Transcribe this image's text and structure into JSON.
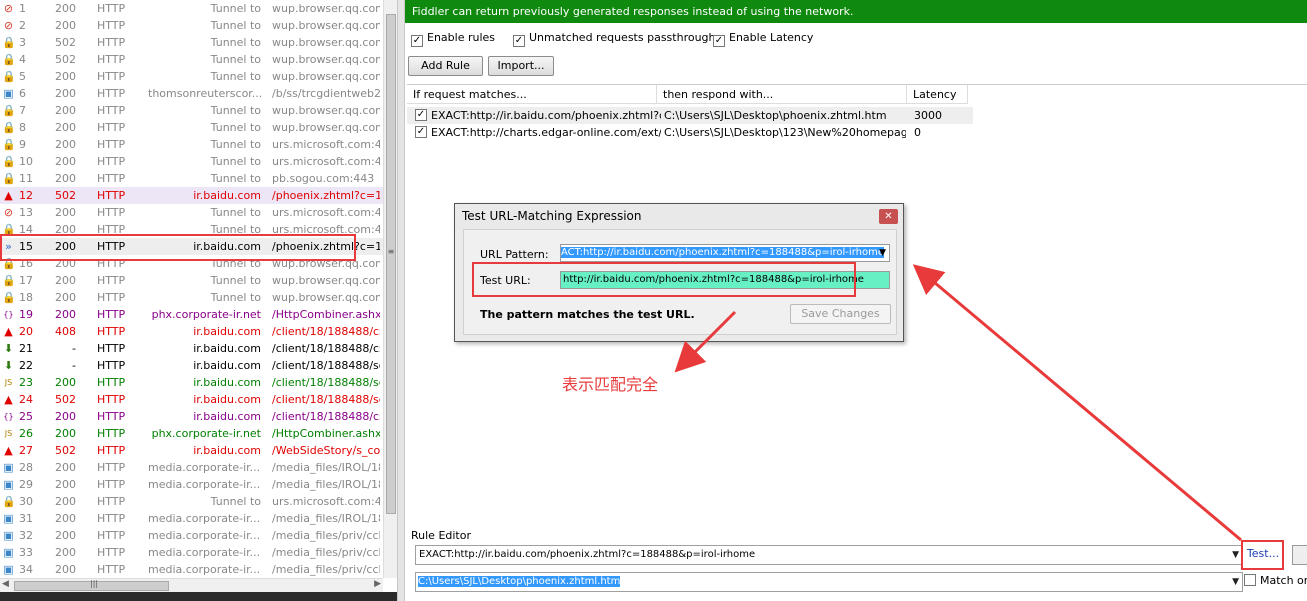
{
  "sessions": [
    {
      "num": "1",
      "result": "200",
      "proto": "HTTP",
      "host": "Tunnel to",
      "url": "wup.browser.qq.com:",
      "icon": "blocked-icon",
      "style": "gray"
    },
    {
      "num": "2",
      "result": "200",
      "proto": "HTTP",
      "host": "Tunnel to",
      "url": "wup.browser.qq.com:",
      "icon": "blocked-icon",
      "style": "gray"
    },
    {
      "num": "3",
      "result": "502",
      "proto": "HTTP",
      "host": "Tunnel to",
      "url": "wup.browser.qq.com:",
      "icon": "lock-icon",
      "style": "gray"
    },
    {
      "num": "4",
      "result": "502",
      "proto": "HTTP",
      "host": "Tunnel to",
      "url": "wup.browser.qq.com:",
      "icon": "lock-icon",
      "style": "gray"
    },
    {
      "num": "5",
      "result": "200",
      "proto": "HTTP",
      "host": "Tunnel to",
      "url": "wup.browser.qq.com:",
      "icon": "lock-icon",
      "style": "gray"
    },
    {
      "num": "6",
      "result": "200",
      "proto": "HTTP",
      "host": "thomsonreuterscor...",
      "url": "/b/ss/trcgdientweb20",
      "icon": "image-icon",
      "style": "gray"
    },
    {
      "num": "7",
      "result": "200",
      "proto": "HTTP",
      "host": "Tunnel to",
      "url": "wup.browser.qq.com:",
      "icon": "lock-icon",
      "style": "gray"
    },
    {
      "num": "8",
      "result": "200",
      "proto": "HTTP",
      "host": "Tunnel to",
      "url": "wup.browser.qq.com:",
      "icon": "lock-icon",
      "style": "gray"
    },
    {
      "num": "9",
      "result": "200",
      "proto": "HTTP",
      "host": "Tunnel to",
      "url": "urs.microsoft.com:443",
      "icon": "lock-icon",
      "style": "gray"
    },
    {
      "num": "10",
      "result": "200",
      "proto": "HTTP",
      "host": "Tunnel to",
      "url": "urs.microsoft.com:443",
      "icon": "lock-icon",
      "style": "gray"
    },
    {
      "num": "11",
      "result": "200",
      "proto": "HTTP",
      "host": "Tunnel to",
      "url": "pb.sogou.com:443",
      "icon": "lock-icon",
      "style": "gray"
    },
    {
      "num": "12",
      "result": "502",
      "proto": "HTTP",
      "host": "ir.baidu.com",
      "url": "/phoenix.zhtml?c=188",
      "icon": "warning-icon",
      "style": "red sel12"
    },
    {
      "num": "13",
      "result": "200",
      "proto": "HTTP",
      "host": "Tunnel to",
      "url": "urs.microsoft.com:443",
      "icon": "blocked-icon",
      "style": "gray"
    },
    {
      "num": "14",
      "result": "200",
      "proto": "HTTP",
      "host": "Tunnel to",
      "url": "urs.microsoft.com:443",
      "icon": "lock-icon",
      "style": "gray"
    },
    {
      "num": "15",
      "result": "200",
      "proto": "HTTP",
      "host": "ir.baidu.com",
      "url": "/phoenix.zhtml?c=188",
      "icon": "autoresponder-icon",
      "style": "black sel15"
    },
    {
      "num": "16",
      "result": "200",
      "proto": "HTTP",
      "host": "Tunnel to",
      "url": "wup.browser.qq.com:",
      "icon": "lock-icon",
      "style": "gray"
    },
    {
      "num": "17",
      "result": "200",
      "proto": "HTTP",
      "host": "Tunnel to",
      "url": "wup.browser.qq.com:",
      "icon": "lock-icon",
      "style": "gray"
    },
    {
      "num": "18",
      "result": "200",
      "proto": "HTTP",
      "host": "Tunnel to",
      "url": "wup.browser.qq.com:",
      "icon": "lock-icon",
      "style": "gray"
    },
    {
      "num": "19",
      "result": "200",
      "proto": "HTTP",
      "host": "phx.corporate-ir.net",
      "url": "/HttpCombiner.ashx?s",
      "icon": "css-icon",
      "style": "purple"
    },
    {
      "num": "20",
      "result": "408",
      "proto": "HTTP",
      "host": "ir.baidu.com",
      "url": "/client/18/188488/css/",
      "icon": "warning-icon",
      "style": "red"
    },
    {
      "num": "21",
      "result": "-",
      "proto": "HTTP",
      "host": "ir.baidu.com",
      "url": "/client/18/188488/css/",
      "icon": "download-icon",
      "style": "black"
    },
    {
      "num": "22",
      "result": "-",
      "proto": "HTTP",
      "host": "ir.baidu.com",
      "url": "/client/18/188488/scri",
      "icon": "download-icon",
      "style": "black"
    },
    {
      "num": "23",
      "result": "200",
      "proto": "HTTP",
      "host": "ir.baidu.com",
      "url": "/client/18/188488/scri",
      "icon": "js-icon",
      "style": "green"
    },
    {
      "num": "24",
      "result": "502",
      "proto": "HTTP",
      "host": "ir.baidu.com",
      "url": "/client/18/188488/scri",
      "icon": "warning-icon",
      "style": "red"
    },
    {
      "num": "25",
      "result": "200",
      "proto": "HTTP",
      "host": "ir.baidu.com",
      "url": "/client/18/188488/css/",
      "icon": "css-icon",
      "style": "purple"
    },
    {
      "num": "26",
      "result": "200",
      "proto": "HTTP",
      "host": "phx.corporate-ir.net",
      "url": "/HttpCombiner.ashx?s",
      "icon": "js-icon",
      "style": "green"
    },
    {
      "num": "27",
      "result": "502",
      "proto": "HTTP",
      "host": "ir.baidu.com",
      "url": "/WebSideStory/s_code",
      "icon": "warning-icon",
      "style": "red"
    },
    {
      "num": "28",
      "result": "200",
      "proto": "HTTP",
      "host": "media.corporate-ir....",
      "url": "/media_files/IROL/18/",
      "icon": "image-icon",
      "style": "gray"
    },
    {
      "num": "29",
      "result": "200",
      "proto": "HTTP",
      "host": "media.corporate-ir....",
      "url": "/media_files/IROL/18/",
      "icon": "image-icon",
      "style": "gray"
    },
    {
      "num": "30",
      "result": "200",
      "proto": "HTTP",
      "host": "Tunnel to",
      "url": "urs.microsoft.com:443",
      "icon": "lock-icon",
      "style": "gray"
    },
    {
      "num": "31",
      "result": "200",
      "proto": "HTTP",
      "host": "media.corporate-ir....",
      "url": "/media_files/IROL/18/",
      "icon": "image-icon",
      "style": "gray"
    },
    {
      "num": "32",
      "result": "200",
      "proto": "HTTP",
      "host": "media.corporate-ir....",
      "url": "/media_files/priv/ccbn",
      "icon": "image-icon",
      "style": "gray"
    },
    {
      "num": "33",
      "result": "200",
      "proto": "HTTP",
      "host": "media.corporate-ir....",
      "url": "/media_files/priv/ccbn",
      "icon": "image-icon",
      "style": "gray"
    },
    {
      "num": "34",
      "result": "200",
      "proto": "HTTP",
      "host": "media.corporate-ir....",
      "url": "/media_files/priv/ccbn",
      "icon": "image-icon",
      "style": "gray"
    }
  ],
  "autoresponder": {
    "banner": "Fiddler can return previously generated responses instead of using the network.",
    "enable_rules": "Enable rules",
    "unmatched_passthrough": "Unmatched requests passthrough",
    "enable_latency": "Enable Latency",
    "add_rule": "Add Rule",
    "import": "Import...",
    "columns": {
      "match": "If request matches...",
      "respond": "then respond with...",
      "latency": "Latency"
    },
    "rules": [
      {
        "match": "EXACT:http://ir.baidu.com/phoenix.zhtml?c...",
        "respond": "C:\\Users\\SJL\\Desktop\\phoenix.zhtml.htm",
        "latency": "3000"
      },
      {
        "match": "EXACT:http://charts.edgar-online.com/ext/c...",
        "respond": "C:\\Users\\SJL\\Desktop\\123\\New%20homepage...",
        "latency": "0"
      }
    ],
    "rule_editor_label": "Rule Editor",
    "rule_match_value": "EXACT:http://ir.baidu.com/phoenix.zhtml?c=188488&p=irol-irhome",
    "rule_response_value": "C:\\Users\\SJL\\Desktop\\phoenix.zhtml.htm",
    "test_button": "Test...",
    "match_once": "Match on"
  },
  "dialog": {
    "title": "Test URL-Matching Expression",
    "close": "✕",
    "url_pattern_label": "URL Pattern:",
    "url_pattern_value": "ACT:http://ir.baidu.com/phoenix.zhtml?c=188488&p=irol-irhome",
    "test_url_label": "Test URL:",
    "test_url_value": "http://ir.baidu.com/phoenix.zhtml?c=188488&p=irol-irhome",
    "result_text": "The pattern matches the test URL.",
    "save_changes": "Save Changes"
  },
  "annotation": "表示匹配完全",
  "colors": {
    "banner": "#0f8a0f",
    "annotation": "#e83a3a",
    "match_field": "#66f0c4",
    "selection": "#3399ff"
  }
}
